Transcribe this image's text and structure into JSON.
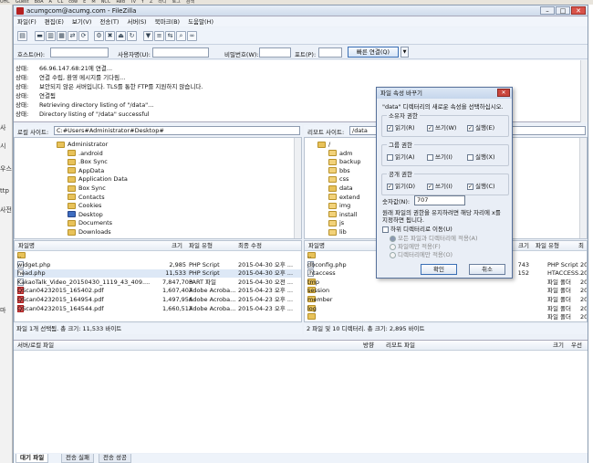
{
  "bookmarks": [
    "UHC",
    "Guest",
    "BoA",
    "A",
    "CL",
    "cow",
    "E",
    "M",
    "NCC",
    "Red",
    "Tv",
    "Y",
    "Z",
    "라디",
    "로그",
    "검색"
  ],
  "left_strip": [
    "사",
    "시",
    "우스",
    "ttp",
    "사전",
    "마"
  ],
  "window": {
    "title": "acumgcom@acumg.com - FileZilla",
    "buttons": [
      "–",
      "□",
      "✕"
    ]
  },
  "menu": [
    "파일(F)",
    "편집(E)",
    "보기(V)",
    "전송(T)",
    "서버(S)",
    "북마크(B)",
    "도움말(H)"
  ],
  "toolbar_icons": [
    "site-manager-icon",
    "toggle-log-icon",
    "toggle-tree-icon",
    "toggle-remote-icon",
    "toggle-queue-icon",
    "refresh-icon",
    "process-queue-icon",
    "cancel-icon",
    "disconnect-icon",
    "reconnect-icon",
    "filter-icon",
    "compare-icon",
    "sync-browse-icon",
    "search-icon",
    "binoculars-icon"
  ],
  "quickconnect": {
    "host_label": "호스트(H):",
    "user_label": "사용자명(U):",
    "pass_label": "비밀번호(W):",
    "port_label": "포트(P):",
    "button": "빠른 연결(Q)",
    "dropdown": "▼"
  },
  "log": [
    {
      "k": "상태:",
      "t": "66.96.147.68:21에 연결..."
    },
    {
      "k": "상태:",
      "t": "연결 수립, 환영 메시지를 기다림..."
    },
    {
      "k": "상태:",
      "t": "보안되지 않은 서버입니다. TLS를 통한 FTP를 지원하지 않습니다."
    },
    {
      "k": "상태:",
      "t": "연결됨"
    },
    {
      "k": "상태:",
      "t": "Retrieving directory listing of \"/data\"..."
    },
    {
      "k": "상태:",
      "t": "Directory listing of \"/data\" successful"
    }
  ],
  "local": {
    "site_label": "로컬 사이트:",
    "site_path": "C:#Users#Administrator#Desktop#",
    "tree": [
      {
        "name": "Administrator",
        "type": "folder",
        "indent": 0
      },
      {
        "name": ".android",
        "type": "folder",
        "indent": 1
      },
      {
        "name": ".Box Sync",
        "type": "folder",
        "indent": 1
      },
      {
        "name": "AppData",
        "type": "folder",
        "indent": 1
      },
      {
        "name": "Application Data",
        "type": "folder",
        "indent": 1
      },
      {
        "name": "Box Sync",
        "type": "folder",
        "indent": 1
      },
      {
        "name": "Contacts",
        "type": "folder",
        "indent": 1
      },
      {
        "name": "Cookies",
        "type": "folder",
        "indent": 1
      },
      {
        "name": "Desktop",
        "type": "blue",
        "indent": 1
      },
      {
        "name": "Documents",
        "type": "folder",
        "indent": 1
      },
      {
        "name": "Downloads",
        "type": "folder",
        "indent": 1
      }
    ],
    "columns": [
      "파일명",
      "크기",
      "파일 유형",
      "최종 수정"
    ],
    "files": [
      {
        "name": "..",
        "size": "",
        "type": "",
        "mod": "",
        "icon": "folder"
      },
      {
        "name": "widget.php",
        "size": "2,985",
        "type": "PHP Script",
        "mod": "2015-04-30 오후 ...",
        "icon": "doc"
      },
      {
        "name": "head.php",
        "size": "11,533",
        "type": "PHP Script",
        "mod": "2015-04-30 오후 ...",
        "icon": "doc",
        "selected": true
      },
      {
        "name": "KakaoTalk_Video_20150430_1119_43_409....",
        "size": "7,847,703",
        "type": "PART 파일",
        "mod": "2015-04-30 오전 ...",
        "icon": "doc"
      },
      {
        "name": "QScan04232015_165402.pdf",
        "size": "1,607,407",
        "type": "Adobe Acroba...",
        "mod": "2015-04-23 오후 ...",
        "icon": "pdf"
      },
      {
        "name": "QScan04232015_164954.pdf",
        "size": "1,497,956",
        "type": "Adobe Acroba...",
        "mod": "2015-04-23 오후 ...",
        "icon": "pdf"
      },
      {
        "name": "QScan04232015_164544.pdf",
        "size": "1,660,517",
        "type": "Adobe Acroba...",
        "mod": "2015-04-23 오후 ...",
        "icon": "pdf"
      }
    ],
    "status": "파일 1개 선택됨. 총 크기: 11,533 바이트"
  },
  "remote": {
    "site_label": "리모트 사이트:",
    "site_path": "/data",
    "tree": [
      {
        "name": "/",
        "type": "folder",
        "indent": 0
      },
      {
        "name": "adm",
        "type": "q",
        "indent": 1
      },
      {
        "name": "backup",
        "type": "q",
        "indent": 1
      },
      {
        "name": "bbs",
        "type": "q",
        "indent": 1
      },
      {
        "name": "css",
        "type": "q",
        "indent": 1
      },
      {
        "name": "data",
        "type": "folder",
        "indent": 1
      },
      {
        "name": "extend",
        "type": "q",
        "indent": 1
      },
      {
        "name": "img",
        "type": "q",
        "indent": 1
      },
      {
        "name": "install",
        "type": "q",
        "indent": 1
      },
      {
        "name": "js",
        "type": "q",
        "indent": 1
      },
      {
        "name": "lib",
        "type": "q",
        "indent": 1
      }
    ],
    "columns": [
      "파일명",
      "크기",
      "파일 유형",
      "최"
    ],
    "files": [
      {
        "name": "..",
        "size": "",
        "type": "",
        "mod": "",
        "icon": "folder"
      },
      {
        "name": "dbconfig.php",
        "size": "743",
        "type": "PHP Script",
        "mod": "20",
        "icon": "doc"
      },
      {
        "name": ".htaccess",
        "size": "152",
        "type": "HTACCESS...",
        "mod": "20",
        "icon": "doc"
      },
      {
        "name": "tmp",
        "size": "",
        "type": "파일 폴더",
        "mod": "20",
        "icon": "folder"
      },
      {
        "name": "session",
        "size": "",
        "type": "파일 폴더",
        "mod": "20",
        "icon": "folder"
      },
      {
        "name": "member",
        "size": "",
        "type": "파일 폴더",
        "mod": "20",
        "icon": "folder"
      },
      {
        "name": "log",
        "size": "",
        "type": "파일 폴더",
        "mod": "20",
        "icon": "folder"
      },
      {
        "name": "",
        "size": "",
        "type": "파일 폴더",
        "mod": "20",
        "icon": "folder"
      }
    ],
    "status": "2 파일 및 10 디렉터리. 총 크기: 2,895 바이트"
  },
  "queue": {
    "columns": [
      "서버/로컬 파일",
      "방향",
      "리모트 파일",
      "크기",
      "우선"
    ]
  },
  "tabs": [
    "대기 파일",
    "전송 실패",
    "전송 성공"
  ],
  "dialog": {
    "title": "파일 속성 바꾸기",
    "desc": "\"data\" 디렉터리의 새로운 속성을 선택하십시오.",
    "owner": "소유자 권한",
    "group": "그룹 권한",
    "public": "공개 권한",
    "read": "읽기(R)",
    "write": "쓰기(W)",
    "exec": "실행(E)",
    "read_g": "읽기(A)",
    "write_g": "쓰기(I)",
    "exec_g": "실행(X)",
    "read_p": "읽기(D)",
    "write_p": "쓰기(I)",
    "exec_p": "실행(C)",
    "owner_checks": [
      true,
      true,
      true
    ],
    "group_checks": [
      false,
      false,
      false
    ],
    "public_checks": [
      true,
      true,
      true
    ],
    "num_label": "숫자값(N):",
    "num_value": "707",
    "note1": "원래 파일의 권한을 유지하려면 해당 자리에 x를",
    "note2": "지정하면 됩니다.",
    "recurse": "하위 디렉터리로 이동(U)",
    "opt1": "모든 파일과 디렉터리에 적용(A)",
    "opt2": "파일에만 적용(F)",
    "opt3": "디렉터리에만 적용(O)",
    "ok": "확인",
    "cancel": "취소"
  }
}
